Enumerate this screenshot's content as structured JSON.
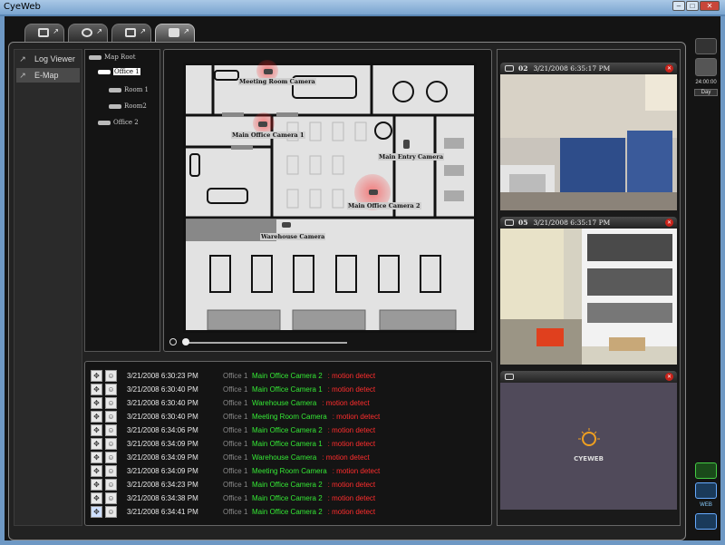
{
  "window": {
    "title": "CyeWeb",
    "buttons": [
      "–",
      "□",
      "✕"
    ]
  },
  "tabs": [
    {
      "name": "tab-live",
      "icon": "monitor-icon"
    },
    {
      "name": "tab-playback",
      "icon": "camera-icon"
    },
    {
      "name": "tab-setup",
      "icon": "config-icon"
    },
    {
      "name": "tab-emap",
      "icon": "map-icon",
      "active": true
    }
  ],
  "leftnav": {
    "items": [
      {
        "label": "Log Viewer",
        "icon": "popout-icon"
      },
      {
        "label": "E-Map",
        "icon": "popout-icon",
        "active": true
      }
    ]
  },
  "tree": {
    "root": "Map Root",
    "office1": "Office 1",
    "room1": "Room 1",
    "room2": "Room2",
    "office2": "Office 2"
  },
  "map": {
    "cameras": {
      "meeting": "Meeting Room Camera",
      "main1": "Main Office Camera 1",
      "entry": "Main Entry Camera",
      "main2": "Main Office Camera 2",
      "warehouse": "Warehouse Camera"
    }
  },
  "log": {
    "entries": [
      {
        "time": "3/21/2008 6:30:23 PM",
        "location": "Office 1",
        "camera": "Main Office Camera 2",
        "event": ": motion detect"
      },
      {
        "time": "3/21/2008 6:30:40 PM",
        "location": "Office 1",
        "camera": "Main Office Camera 1",
        "event": ": motion detect"
      },
      {
        "time": "3/21/2008 6:30:40 PM",
        "location": "Office 1",
        "camera": "Warehouse Camera",
        "event": ": motion detect"
      },
      {
        "time": "3/21/2008 6:30:40 PM",
        "location": "Office 1",
        "camera": "Meeting Room Camera",
        "event": ": motion detect"
      },
      {
        "time": "3/21/2008 6:34:06 PM",
        "location": "Office 1",
        "camera": "Main Office Camera 2",
        "event": ": motion detect"
      },
      {
        "time": "3/21/2008 6:34:09 PM",
        "location": "Office 1",
        "camera": "Main Office Camera 1",
        "event": ": motion detect"
      },
      {
        "time": "3/21/2008 6:34:09 PM",
        "location": "Office 1",
        "camera": "Warehouse Camera",
        "event": ": motion detect"
      },
      {
        "time": "3/21/2008 6:34:09 PM",
        "location": "Office 1",
        "camera": "Meeting Room Camera",
        "event": ": motion detect"
      },
      {
        "time": "3/21/2008 6:34:23 PM",
        "location": "Office 1",
        "camera": "Main Office Camera 2",
        "event": ": motion detect"
      },
      {
        "time": "3/21/2008 6:34:38 PM",
        "location": "Office 1",
        "camera": "Main Office Camera 2",
        "event": ": motion detect"
      },
      {
        "time": "3/21/2008 6:34:41 PM",
        "location": "Office 1",
        "camera": "Main Office Camera 2",
        "event": ": motion detect"
      }
    ]
  },
  "video": {
    "panels": [
      {
        "channel": "02",
        "timestamp": "3/21/2008 6:35:17 PM"
      },
      {
        "channel": "05",
        "timestamp": "3/21/2008 6:35:17 PM"
      },
      {
        "channel": "",
        "timestamp": ""
      }
    ],
    "logo_text": "CYEWEB"
  },
  "rail": {
    "clock": "24:00:00",
    "mode": "Day",
    "web_label": "WEB"
  },
  "colors": {
    "event_camera": "#35e835",
    "event_text": "#ff2d2d",
    "motion_glow": "#ff2828"
  }
}
